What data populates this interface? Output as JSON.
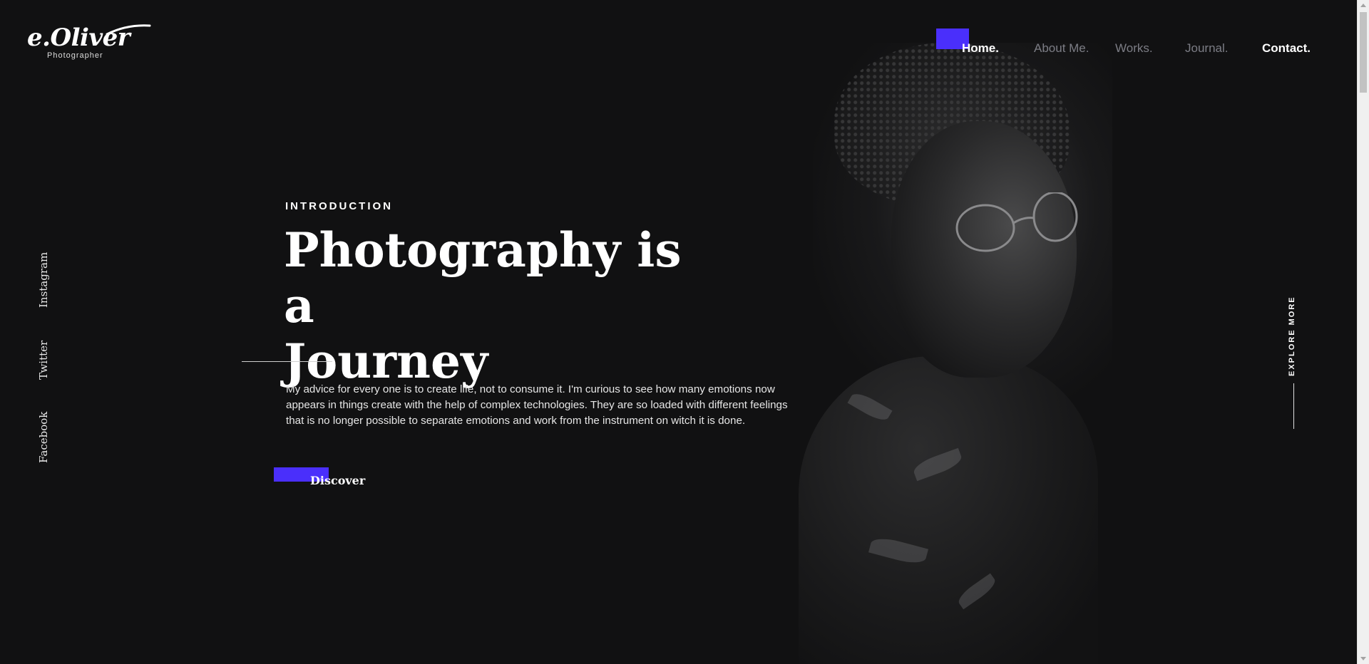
{
  "logo": {
    "name": "e.Oliver",
    "subtitle": "Photographer"
  },
  "nav": {
    "items": [
      {
        "label": "Home."
      },
      {
        "label": "About Me."
      },
      {
        "label": "Works."
      },
      {
        "label": "Journal."
      },
      {
        "label": "Contact."
      }
    ]
  },
  "social": {
    "items": [
      {
        "label": "Instagram"
      },
      {
        "label": "Twitter"
      },
      {
        "label": "Facebook"
      }
    ]
  },
  "hero": {
    "eyebrow": "INTRODUCTION",
    "headline_line1": "Photography is a",
    "headline_line2": "Journey",
    "description": "My advice for every one is to create life, not to consume it. I'm curious to see how many emotions now appears in things create with the help of complex technologies. They are so loaded with different feelings that is no longer possible to separate emotions and work from the instrument on witch it is done.",
    "cta_label": "Discover"
  },
  "explore": {
    "label": "EXPLORE MORE"
  },
  "colors": {
    "background": "#111112",
    "accent": "#4a2ffb",
    "nav_muted": "#7c7d85",
    "text": "#ffffff"
  }
}
